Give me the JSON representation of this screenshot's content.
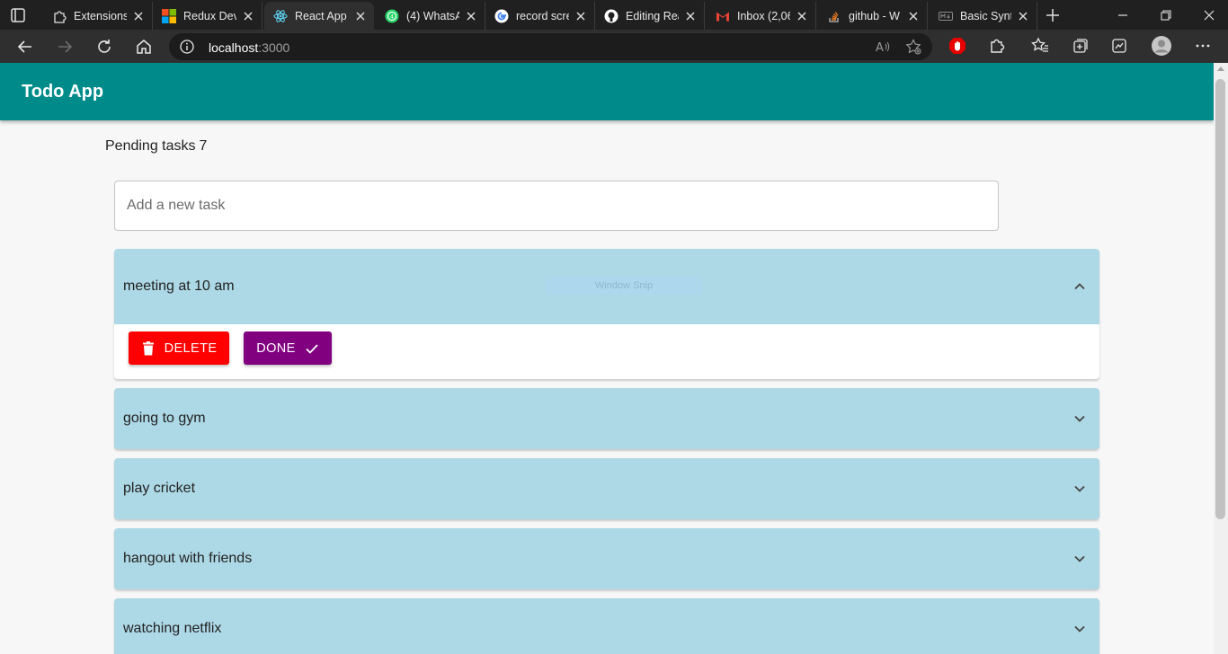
{
  "browser": {
    "tabs": [
      {
        "label": "Extensions",
        "icon": "puzzle-icon"
      },
      {
        "label": "Redux Dev",
        "icon": "microsoft-logo-icon"
      },
      {
        "label": "React App",
        "icon": "react-logo-icon",
        "active": true
      },
      {
        "label": "(4) WhatsA",
        "icon": "whatsapp-logo-icon"
      },
      {
        "label": "record scre",
        "icon": "google-logo-icon"
      },
      {
        "label": "Editing Rea",
        "icon": "github-logo-icon"
      },
      {
        "label": "Inbox (2,06",
        "icon": "gmail-logo-icon"
      },
      {
        "label": "github - W",
        "icon": "stackoverflow-logo-icon"
      },
      {
        "label": "Basic Synta",
        "icon": "markdown-logo-icon"
      }
    ],
    "address": {
      "host": "localhost",
      "port": ":3000"
    }
  },
  "app": {
    "title": "Todo App",
    "pending_label": "Pending tasks",
    "pending_count": "7",
    "input_placeholder": "Add a new task",
    "overlay_text": "Window Snip",
    "tasks": [
      {
        "title": "meeting at 10 am",
        "expanded": true
      },
      {
        "title": "going to gym",
        "expanded": false
      },
      {
        "title": "play cricket",
        "expanded": false
      },
      {
        "title": "hangout with friends",
        "expanded": false
      },
      {
        "title": "watching netflix",
        "expanded": false
      }
    ],
    "actions": {
      "delete_label": "DELETE",
      "done_label": "DONE"
    }
  },
  "colors": {
    "appbar": "#008b8b",
    "accordion": "#add8e6",
    "delete": "#ff0000",
    "done": "#800080"
  }
}
